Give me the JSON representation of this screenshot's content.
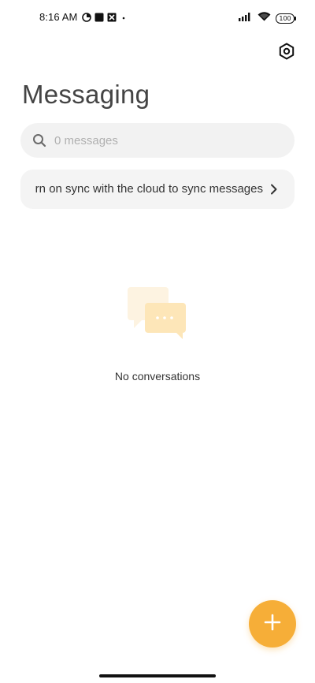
{
  "status_bar": {
    "time": "8:16 AM",
    "battery": "100",
    "left_icons": [
      "data-saver-icon",
      "square-notification-icon",
      "app-notification-icon",
      "dot-icon"
    ],
    "right_icons": [
      "signal-icon",
      "wifi-icon",
      "battery-icon"
    ]
  },
  "header": {
    "title": "Messaging",
    "settings_icon": "settings-hex-icon"
  },
  "search": {
    "placeholder": "0 messages",
    "icon": "search-icon"
  },
  "sync_banner": {
    "text": "Turn on sync with the cloud to sync messages",
    "chevron": "chevron-right-icon"
  },
  "empty_state": {
    "icon": "chat-bubbles-icon",
    "text": "No conversations"
  },
  "fab": {
    "icon": "plus-icon",
    "color": "#f6ae38"
  }
}
